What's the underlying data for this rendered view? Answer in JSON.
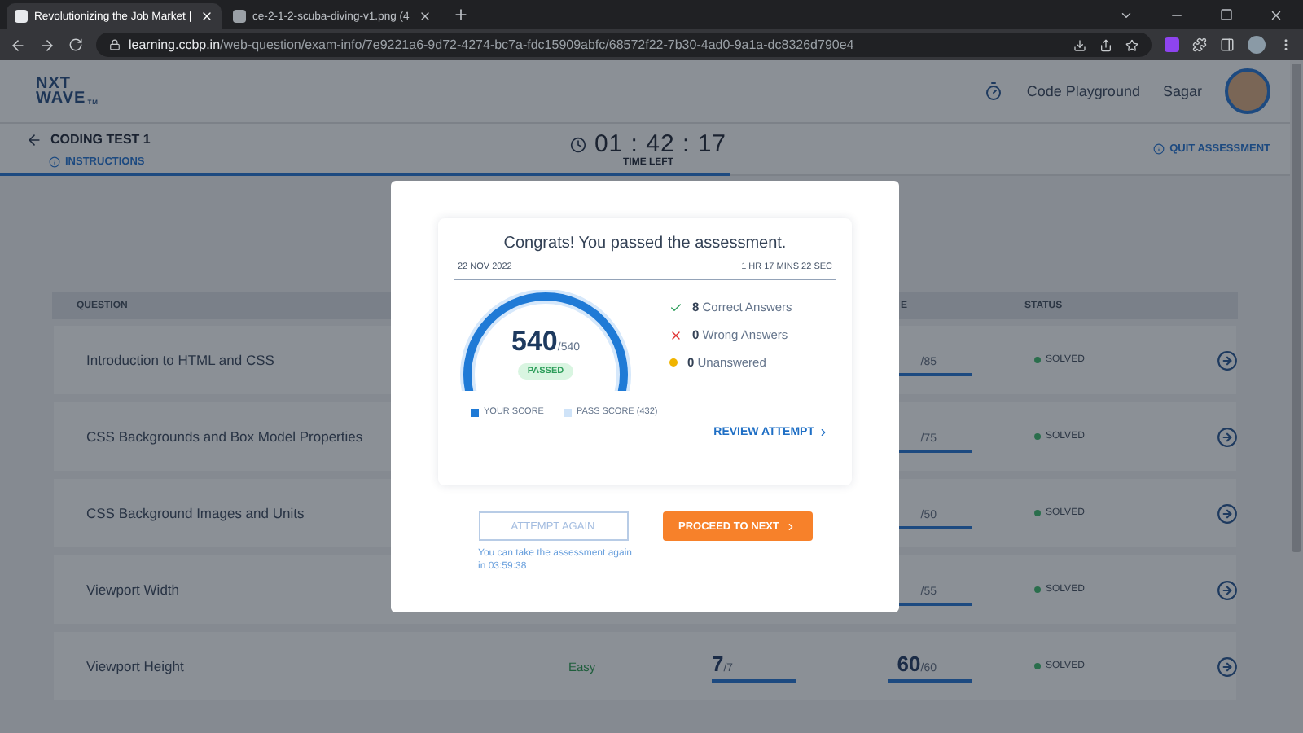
{
  "browser": {
    "tabs": [
      {
        "title": "Revolutionizing the Job Market |",
        "selected": true
      },
      {
        "title": "ce-2-1-2-scuba-diving-v1.png (4",
        "selected": false
      }
    ],
    "url_host": "learning.ccbp.in",
    "url_path": "/web-question/exam-info/7e9221a6-9d72-4274-bc7a-fdc15909abfc/68572f22-7b30-4ad0-9a1a-dc8326d790e4"
  },
  "header": {
    "logo_top": "NXT",
    "logo_bottom": "WAVE",
    "logo_mark": "TM",
    "links": [
      "Code Playground",
      "Sagar"
    ]
  },
  "subheader": {
    "title": "CODING TEST 1",
    "instructions": "INSTRUCTIONS",
    "timer": "01 : 42 : 17",
    "timer_label": "TIME LEFT",
    "quit": "QUIT ASSESSMENT",
    "time_bar": {
      "level": 0.56
    }
  },
  "table": {
    "columns": [
      {
        "label": "QUESTION",
        "kind": "question"
      },
      {
        "label": "E",
        "kind": "score"
      },
      {
        "label": "STATUS",
        "kind": "status"
      }
    ],
    "rows": [
      {
        "question": "Introduction to HTML and CSS",
        "score": {
          "total": "/85",
          "level": 1
        },
        "status": "SOLVED",
        "color": "#2a6e4c"
      },
      {
        "question": "CSS Backgrounds and Box Model Properties",
        "score": {
          "total": "/75",
          "level": 1
        },
        "status": "SOLVED",
        "color": "#2a6e4c"
      },
      {
        "question": "CSS Background Images and Units",
        "score": {
          "total": "/50",
          "level": 1
        },
        "status": "SOLVED",
        "color": "#2a6e4c"
      },
      {
        "question": "Viewport Width",
        "score": {
          "total": "/55",
          "level": 1
        },
        "status": "SOLVED",
        "color": "#2a6e4c"
      },
      {
        "question": "Viewport Height",
        "difficulty": "Easy",
        "accuracy": {
          "got": "7",
          "total": "/7",
          "level": 1
        },
        "score": {
          "got": "60",
          "total": "/60",
          "level": 1
        },
        "status": "SOLVED",
        "color": "#2a6e4c"
      }
    ]
  },
  "modal": {
    "title": "Congrats! You passed the assessment.",
    "date": "22 NOV 2022",
    "duration": "1 HR 17 MINS 22 SEC",
    "gauge": {
      "score": "540",
      "total": "/540",
      "badge": "PASSED",
      "level": 1
    },
    "stats": [
      {
        "kind": "correct",
        "count": "8",
        "label": "Correct Answers"
      },
      {
        "kind": "wrong",
        "count": "0",
        "label": "Wrong Answers"
      },
      {
        "kind": "unanswered",
        "count": "0",
        "label": "Unanswered"
      }
    ],
    "legend": [
      "YOUR SCORE",
      "PASS SCORE (432)"
    ],
    "review": "REVIEW ATTEMPT",
    "attempt_again": "ATTEMPT AGAIN",
    "proceed": "PROCEED TO NEXT",
    "note": "You can take the assessment again in 03:59:38"
  }
}
